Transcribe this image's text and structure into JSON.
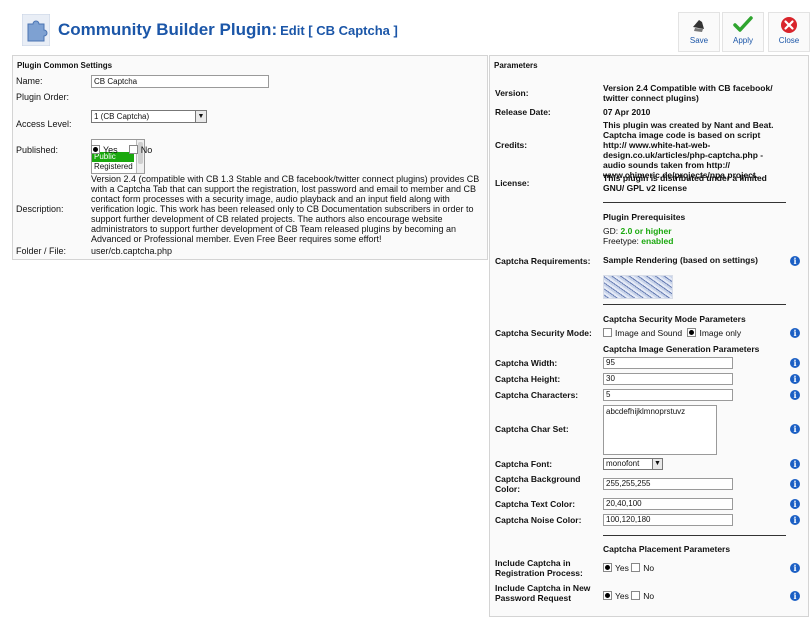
{
  "header": {
    "title": "Community Builder Plugin:",
    "subtitle": "Edit [ CB Captcha ]",
    "toolbar": {
      "save_label": "Save",
      "apply_label": "Apply",
      "close_label": "Close"
    }
  },
  "left_panel": {
    "heading": "Plugin Common Settings",
    "name_label": "Name:",
    "name_value": "CB Captcha",
    "order_label": "Plugin Order:",
    "order_value": "1 (CB Captcha)",
    "access_label": "Access Level:",
    "access_options": [
      "Public",
      "Registered"
    ],
    "access_selected": "Public",
    "published_label": "Published:",
    "published_yes": "Yes",
    "published_no": "No",
    "description_label": "Description:",
    "description_text": "Version 2.4 (compatible with CB 1.3 Stable and CB facebook/twitter connect plugins) provides CB with a Captcha Tab that can support the registration, lost password and email to member and CB contact form processes with a security image, audio playback and an input field along with verification logic. This work has been released only to CB Documentation subscribers in order to support further development of CB related projects. The authors also encourage website administrators to support further development of CB Team released plugins by becoming an Advanced or Professional member. Even Free Beer requires some effort!",
    "folder_label": "Folder / File:",
    "folder_value": "user/cb.captcha.php"
  },
  "right_panel": {
    "heading": "Parameters",
    "version_label": "Version:",
    "version_value": "Version 2.4 Compatible with CB facebook/ twitter connect plugins)",
    "release_label": "Release Date:",
    "release_value": "07 Apr 2010",
    "credits_label": "Credits:",
    "credits_value": "This plugin was created by Nant and Beat. Captcha image code is based on script http:// www.white-hat-web-design.co.uk/articles/php-captcha.php - audio sounds taken from http:// www.chimeric.de/projects/npa project.",
    "license_label": "License:",
    "license_value": "This plugin is distributed under a limited GNU/ GPL v2 license",
    "prereq_heading": "Plugin Prerequisites",
    "gd_label": "GD:",
    "gd_value": "2.0 or higher",
    "freetype_label": "Freetype:",
    "freetype_value": "enabled",
    "requirements_label": "Captcha Requirements:",
    "requirements_value": "Sample Rendering (based on settings)",
    "security_heading": "Captcha Security Mode Parameters",
    "security_label": "Captcha Security Mode:",
    "security_opt1": "Image and Sound",
    "security_opt2": "Image only",
    "imagegen_heading": "Captcha Image Generation Parameters",
    "width_label": "Captcha Width:",
    "width_value": "95",
    "height_label": "Captcha Height:",
    "height_value": "30",
    "chars_label": "Captcha Characters:",
    "chars_value": "5",
    "charset_label": "Captcha Char Set:",
    "charset_value": "abcdefhijklmnoprstuvz",
    "font_label": "Captcha Font:",
    "font_value": "monofont",
    "bg_label": "Captcha Background Color:",
    "bg_value": "255,255,255",
    "textcolor_label": "Captcha Text Color:",
    "textcolor_value": "20,40,100",
    "noise_label": "Captcha Noise Color:",
    "noise_value": "100,120,180",
    "placement_heading": "Captcha Placement Parameters",
    "reg_label": "Include Captcha in Registration Process:",
    "reg_yes": "Yes",
    "reg_no": "No",
    "pwd_label": "Include Captcha in New Password Request",
    "pwd_yes": "Yes",
    "pwd_no": "No",
    "info_glyph": "i"
  },
  "colors": {
    "brand": "#1b56a8",
    "selected_option": "#1aa80e",
    "info_icon": "#1b5fc4",
    "close_icon": "#d9242b",
    "apply_icon": "#2fa52f"
  }
}
